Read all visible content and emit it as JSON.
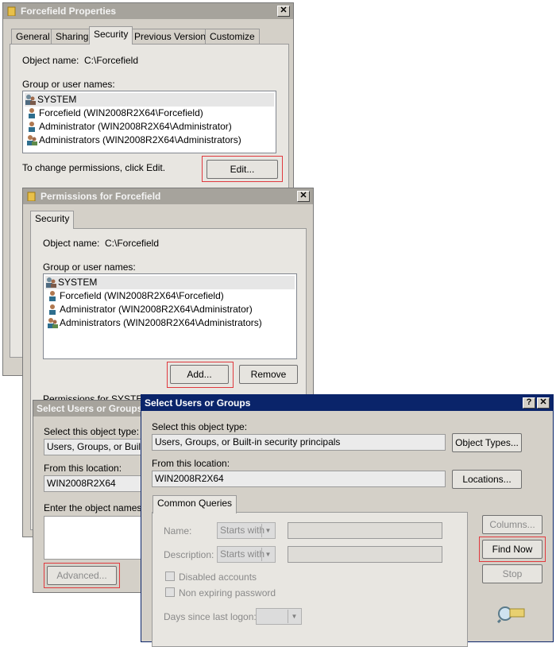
{
  "props": {
    "title": "Forcefield Properties",
    "close": "✕",
    "tabs": [
      "General",
      "Sharing",
      "Security",
      "Previous Versions",
      "Customize"
    ],
    "object_label": "Object name:",
    "object_value": "C:\\Forcefield",
    "group_label": "Group or user names:",
    "users": [
      "SYSTEM",
      "Forcefield (WIN2008R2X64\\Forcefield)",
      "Administrator (WIN2008R2X64\\Administrator)",
      "Administrators (WIN2008R2X64\\Administrators)"
    ],
    "change_text": "To change permissions, click Edit.",
    "edit_button": "Edit..."
  },
  "perms": {
    "title": "Permissions for Forcefield",
    "close": "✕",
    "tab": "Security",
    "object_label": "Object name:",
    "object_value": "C:\\Forcefield",
    "group_label": "Group or user names:",
    "users": [
      "SYSTEM",
      "Forcefield (WIN2008R2X64\\Forcefield)",
      "Administrator (WIN2008R2X64\\Administrator)",
      "Administrators (WIN2008R2X64\\Administrators)"
    ],
    "add_button": "Add...",
    "remove_button": "Remove",
    "permissions_label": "Permissions for SYSTEM"
  },
  "sel_bg": {
    "title": "Select Users or Groups",
    "object_type_label": "Select this object type:",
    "object_type_value": "Users, Groups, or Built-in",
    "location_label": "From this location:",
    "location_value": "WIN2008R2X64",
    "enter_label": "Enter the object names to",
    "advanced_button": "Advanced..."
  },
  "sel_fg": {
    "title": "Select Users or Groups",
    "help": "?",
    "close": "✕",
    "object_type_label": "Select this object type:",
    "object_type_value": "Users, Groups, or Built-in security principals",
    "object_types_button": "Object Types...",
    "location_label": "From this location:",
    "location_value": "WIN2008R2X64",
    "locations_button": "Locations...",
    "tab": "Common Queries",
    "name_label": "Name:",
    "name_mode": "Starts with",
    "desc_label": "Description:",
    "desc_mode": "Starts with",
    "disabled_accounts": "Disabled accounts",
    "non_expiring": "Non expiring password",
    "days_label": "Days since last logon:",
    "columns_button": "Columns...",
    "find_now_button": "Find Now",
    "stop_button": "Stop"
  },
  "colors": {
    "highlight": "#e0393e",
    "active_title": "#0a246a"
  }
}
